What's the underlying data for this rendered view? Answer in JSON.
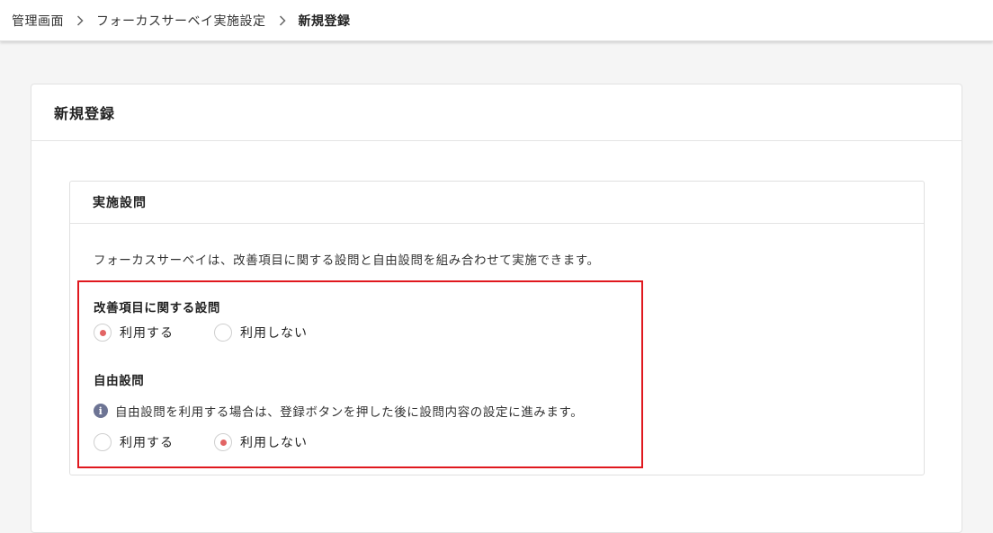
{
  "breadcrumb": {
    "items": [
      "管理画面",
      "フォーカスサーベイ実施設定",
      "新規登録"
    ]
  },
  "card": {
    "title": "新規登録"
  },
  "panel": {
    "title": "実施設問",
    "description": "フォーカスサーベイは、改善項目に関する設問と自由設問を組み合わせて実施できます。"
  },
  "improvement_question": {
    "title": "改善項目に関する設問",
    "options": [
      "利用する",
      "利用しない"
    ],
    "selected": "利用する"
  },
  "free_question": {
    "title": "自由設問",
    "info": "自由設問を利用する場合は、登録ボタンを押した後に設問内容の設定に進みます。",
    "options": [
      "利用する",
      "利用しない"
    ],
    "selected": "利用しない"
  },
  "colors": {
    "highlight_border": "#e0181e",
    "radio_selected": "#e26464",
    "info_icon": "#6d7494"
  }
}
